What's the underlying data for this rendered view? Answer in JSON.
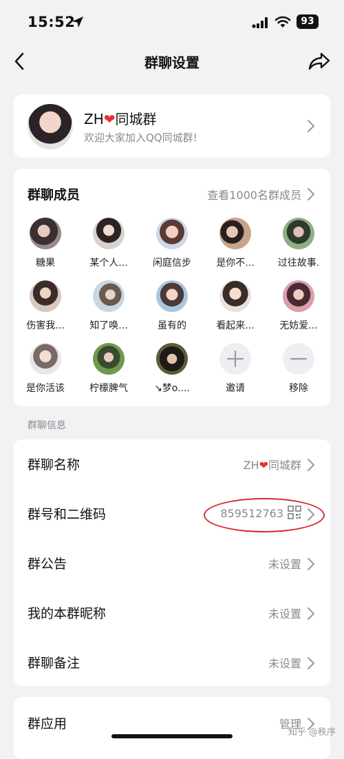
{
  "status_bar": {
    "time": "15:52",
    "battery": "93"
  },
  "nav": {
    "title": "群聊设置"
  },
  "group": {
    "name_prefix": "ZH",
    "name_suffix": "同城群",
    "description": "欢迎大家加入QQ同城群!"
  },
  "members": {
    "title": "群聊成员",
    "view_all": "查看1000名群成员",
    "list": [
      {
        "name": "糖果"
      },
      {
        "name": "某个人..."
      },
      {
        "name": "闲庭信步"
      },
      {
        "name": "是你不..."
      },
      {
        "name": "过往故事."
      },
      {
        "name": "伤害我..."
      },
      {
        "name": "知了唤..."
      },
      {
        "name": "虽有的"
      },
      {
        "name": "看起来..."
      },
      {
        "name": "无妨爱..."
      },
      {
        "name": "是你活该"
      },
      {
        "name": "柠檬脾气"
      },
      {
        "name": "↘梦o...."
      }
    ],
    "invite_label": "邀请",
    "remove_label": "移除"
  },
  "info_section_label": "群聊信息",
  "info_rows": {
    "name": {
      "label": "群聊名称",
      "value_prefix": "ZH",
      "value_suffix": "同城群"
    },
    "number": {
      "label": "群号和二维码",
      "value": "859512763"
    },
    "notice": {
      "label": "群公告",
      "value": "未设置"
    },
    "nickname": {
      "label": "我的本群昵称",
      "value": "未设置"
    },
    "remark": {
      "label": "群聊备注",
      "value": "未设置"
    }
  },
  "apps": {
    "label": "群应用",
    "value": "管理"
  },
  "watermark": "知乎 @秩序",
  "colors": {
    "background": "#f2f2f5",
    "card": "#ffffff",
    "secondary_text": "#8a8a8e",
    "heart": "#e8312f",
    "annotation_ring": "#d8262c"
  }
}
